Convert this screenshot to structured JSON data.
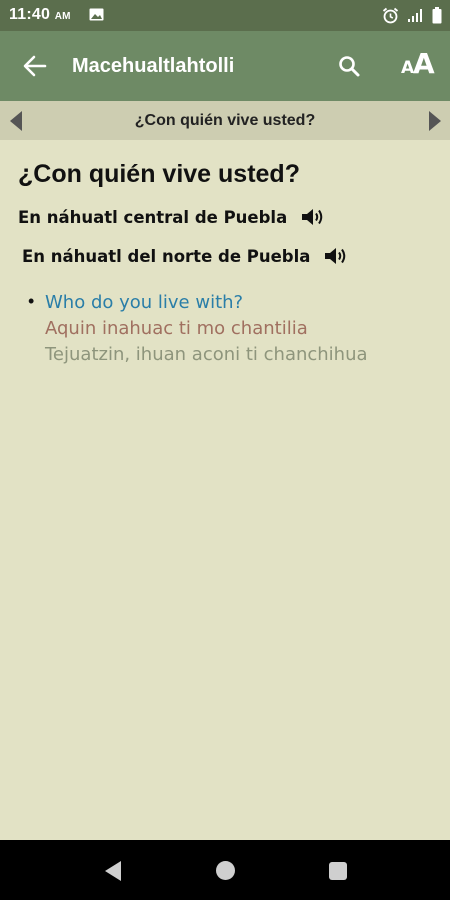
{
  "status_bar": {
    "time": "11:40",
    "ampm": "AM",
    "icons": [
      "image-icon",
      "alarm-icon",
      "signal-icon",
      "battery-icon"
    ]
  },
  "app_bar": {
    "title": "Macehualtlahtolli",
    "icons": [
      "back-arrow-icon",
      "search-icon",
      "font-size-icon"
    ],
    "font_icon_small": "A",
    "font_icon_large": "A"
  },
  "navigator": {
    "title": "¿Con quién vive usted?",
    "icons": [
      "chevron-left-icon",
      "chevron-right-icon"
    ]
  },
  "content": {
    "heading": "¿Con quién vive usted?",
    "dialects": [
      {
        "label": "En náhuatl central de Puebla",
        "icon": "speaker-icon"
      },
      {
        "label": "En náhuatl del norte de Puebla",
        "icon": "speaker-icon"
      }
    ],
    "entry": {
      "bullet": "•",
      "english": "Who do you live with?",
      "central": "Aquin inahuac ti mo chantilia",
      "north": "Tejuatzin, ihuan aconi ti chanchihua"
    }
  },
  "system_nav": {
    "icons": [
      "back-triangle-icon",
      "home-circle-icon",
      "recents-square-icon"
    ]
  },
  "colors": {
    "status_bar": "#5b6e4d",
    "app_bar": "#6e8a65",
    "nav_bar": "#cdcdb1",
    "background": "#e2e2c5",
    "english_text": "#2a7ea8",
    "central_text": "#a07060",
    "north_text": "#8e957c"
  }
}
